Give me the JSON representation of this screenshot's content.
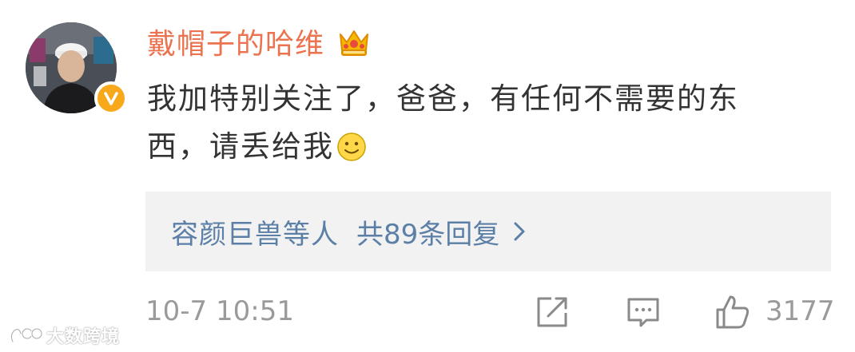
{
  "comment": {
    "username": "戴帽子的哈维",
    "text_line1": "我加特别关注了，爸爸，有任何不需要的东",
    "text_line2": "西，请丢给我",
    "emoji": "smile-emoji",
    "verified": true
  },
  "replies": {
    "users": "容颜巨兽等人",
    "count_label": "共89条回复"
  },
  "footer": {
    "timestamp": "10-7 10:51",
    "like_count": "3177"
  },
  "watermark": {
    "text": "大数跨境"
  },
  "colors": {
    "username": "#eb7350",
    "link": "#5b7fa6",
    "badge": "#f7a81b",
    "meta": "#9a9a9a"
  },
  "icons": [
    "crown-icon",
    "verified-icon",
    "smile-icon",
    "chevron-right-icon",
    "repost-icon",
    "comment-icon",
    "like-icon"
  ]
}
